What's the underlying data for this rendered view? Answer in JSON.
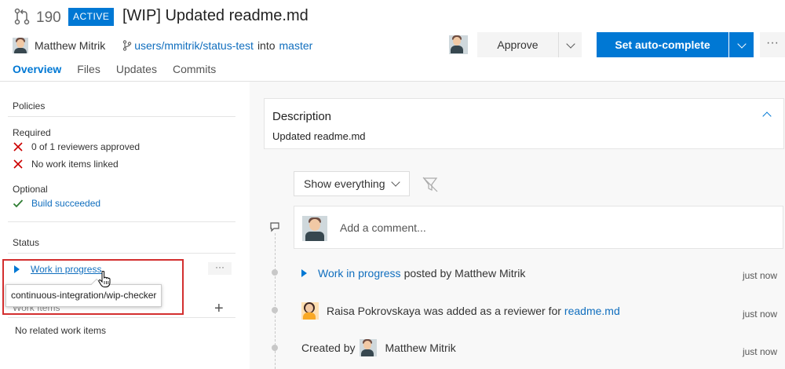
{
  "header": {
    "pr_number": "190",
    "status_badge": "ACTIVE",
    "title": "[WIP] Updated readme.md",
    "author": "Matthew Mitrik",
    "source_branch": "users/mmitrik/status-test",
    "into_text": "into",
    "target_branch": "master",
    "tabs": [
      {
        "label": "Overview"
      },
      {
        "label": "Files"
      },
      {
        "label": "Updates"
      },
      {
        "label": "Commits"
      }
    ],
    "approve_label": "Approve",
    "auto_complete_label": "Set auto-complete",
    "more_label": "···"
  },
  "left": {
    "policies_title": "Policies",
    "required_label": "Required",
    "required_items": [
      "0 of 1 reviewers approved",
      "No work items linked"
    ],
    "optional_label": "Optional",
    "optional_item": "Build succeeded",
    "status_title": "Status",
    "status_item": "Work in progress",
    "status_more": "···",
    "tooltip": "continuous-integration/wip-checker",
    "work_items_title": "Work Items",
    "add_label": "+",
    "no_work_items": "No related work items"
  },
  "right": {
    "description_title": "Description",
    "description_text": "Updated readme.md",
    "filter_label": "Show everything",
    "comment_placeholder": "Add a comment...",
    "timeline": [
      {
        "link": "Work in progress",
        "text": "posted by Matthew Mitrik",
        "time": "just now"
      },
      {
        "name": "Raisa Pokrovskaya",
        "text": "was added as a reviewer for",
        "link": "readme.md",
        "time": "just now"
      },
      {
        "prefix": "Created by",
        "name": "Matthew Mitrik",
        "time": "just now"
      }
    ]
  },
  "colors": {
    "accent": "#0078d4",
    "error": "#cc0000",
    "success": "#2e7d32",
    "highlight_box": "#d32f2f"
  },
  "icons": {
    "pr": "pull-request-icon",
    "branch": "branch-icon",
    "fail": "x-icon",
    "pass": "check-icon",
    "filter": "filter-icon",
    "comment": "comment-icon"
  }
}
